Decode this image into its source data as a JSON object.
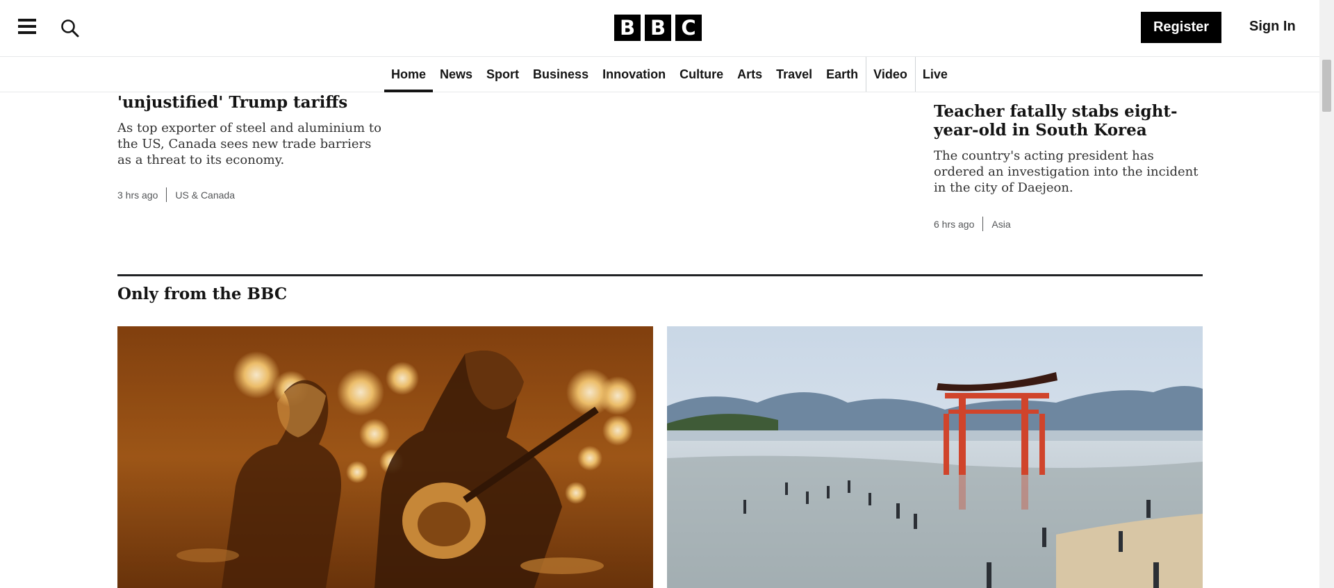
{
  "header": {
    "logo_letters": [
      "B",
      "B",
      "C"
    ],
    "register_label": "Register",
    "signin_label": "Sign In",
    "icons": {
      "menu": "hamburger-menu-icon",
      "search": "search-icon"
    }
  },
  "nav": {
    "items": [
      {
        "label": "Home",
        "active": true
      },
      {
        "label": "News"
      },
      {
        "label": "Sport"
      },
      {
        "label": "Business"
      },
      {
        "label": "Innovation"
      },
      {
        "label": "Culture"
      },
      {
        "label": "Arts"
      },
      {
        "label": "Travel"
      },
      {
        "label": "Earth"
      },
      {
        "label": "Video"
      },
      {
        "label": "Live"
      }
    ]
  },
  "stories": {
    "left": {
      "headline": "'unjustified' Trump tariffs",
      "summary": "As top exporter of steel and aluminium to the US, Canada sees new trade barriers as a threat to its economy.",
      "time": "3 hrs ago",
      "category": "US & Canada"
    },
    "right": {
      "headline": "Teacher fatally stabs eight-year-old in South Korea",
      "summary": "The country's acting president has ordered an investigation into the incident in the city of Daejeon.",
      "time": "6 hrs ago",
      "category": "Asia"
    }
  },
  "section": {
    "title": "Only from the BBC"
  },
  "colors": {
    "background": "#ffffff",
    "text": "#141414",
    "logo_bg": "#000000",
    "register_bg": "#000000",
    "rule": "#202224"
  }
}
